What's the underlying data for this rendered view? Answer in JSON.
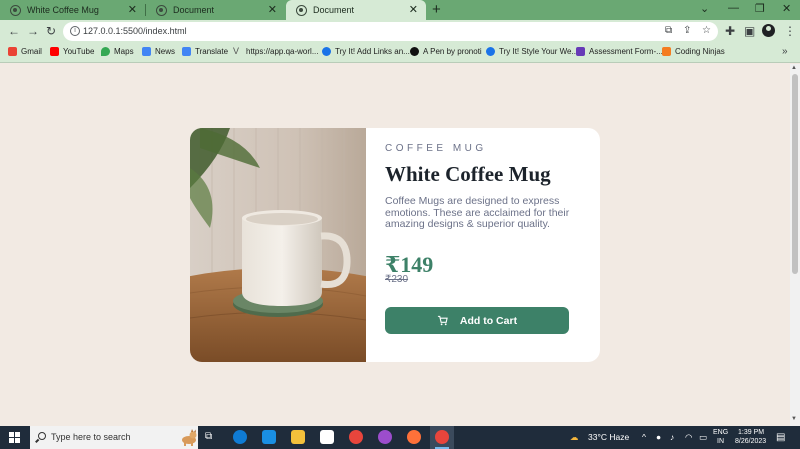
{
  "browser": {
    "tabs": [
      {
        "title": "White Coffee Mug",
        "active": false
      },
      {
        "title": "Document",
        "active": false
      },
      {
        "title": "Document",
        "active": true
      }
    ],
    "address": "127.0.0.1:5500/index.html",
    "bookmarks": [
      {
        "label": "Gmail",
        "icon": "gmail-icon"
      },
      {
        "label": "YouTube",
        "icon": "youtube-icon"
      },
      {
        "label": "Maps",
        "icon": "maps-icon"
      },
      {
        "label": "News",
        "icon": "news-icon"
      },
      {
        "label": "Translate",
        "icon": "translate-icon"
      },
      {
        "label": "https://app.qa-worl...",
        "icon": "v-icon"
      },
      {
        "label": "Try It! Add Links an...",
        "icon": "c-icon"
      },
      {
        "label": "A Pen by pronoti",
        "icon": "codepen-icon"
      },
      {
        "label": "Try It! Style Your We...",
        "icon": "c-icon"
      },
      {
        "label": "Assessment Form-...",
        "icon": "forms-icon"
      },
      {
        "label": "Coding Ninjas",
        "icon": "ninja-icon"
      }
    ]
  },
  "product": {
    "category": "COFFEE MUG",
    "name": "White Coffee Mug",
    "description": "Coffee Mugs are designed to express emotions. These are acclaimed for their amazing designs & superior quality.",
    "price": "₹149",
    "old_price": "₹230",
    "button_label": "Add to Cart",
    "accent_color": "#3d8168"
  },
  "taskbar": {
    "search_placeholder": "Type here to search",
    "weather": "33°C  Haze",
    "language": "ENG",
    "region": "IN",
    "time": "1:39 PM",
    "date": "8/26/2023"
  }
}
